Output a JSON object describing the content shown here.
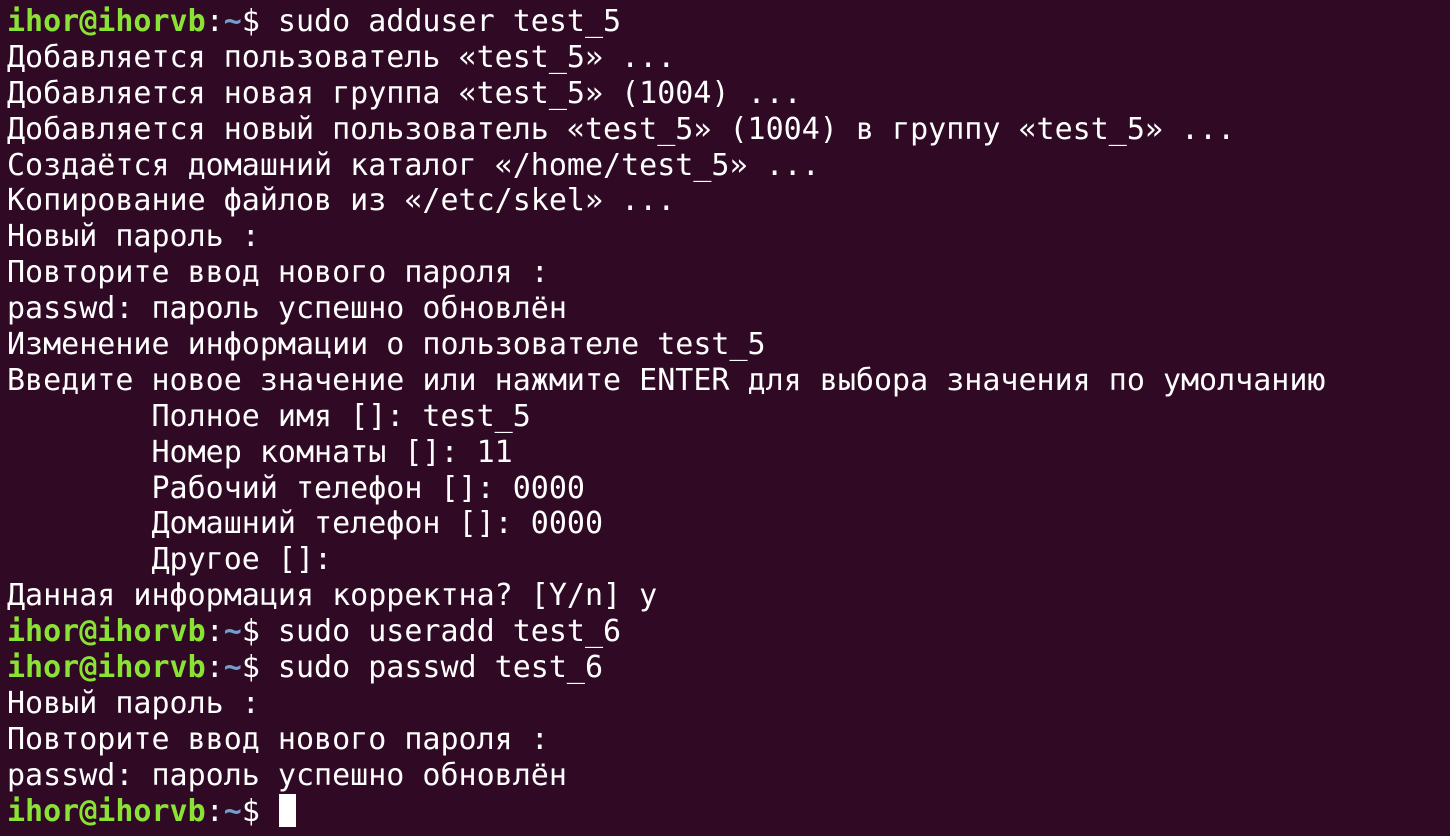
{
  "prompt": {
    "user_host": "ihor@ihorvb",
    "colon": ":",
    "path": "~",
    "dollar": "$"
  },
  "lines": [
    {
      "type": "prompt",
      "command": " sudo adduser test_5"
    },
    {
      "type": "output",
      "text": "Добавляется пользователь «test_5» ..."
    },
    {
      "type": "output",
      "text": "Добавляется новая группа «test_5» (1004) ..."
    },
    {
      "type": "output",
      "text": "Добавляется новый пользователь «test_5» (1004) в группу «test_5» ..."
    },
    {
      "type": "output",
      "text": "Создаётся домашний каталог «/home/test_5» ..."
    },
    {
      "type": "output",
      "text": "Копирование файлов из «/etc/skel» ..."
    },
    {
      "type": "output",
      "text": "Новый пароль :"
    },
    {
      "type": "output",
      "text": "Повторите ввод нового пароля :"
    },
    {
      "type": "output",
      "text": "passwd: пароль успешно обновлён"
    },
    {
      "type": "output",
      "text": "Изменение информации о пользователе test_5"
    },
    {
      "type": "output",
      "text": "Введите новое значение или нажмите ENTER для выбора значения по умолчанию"
    },
    {
      "type": "output",
      "text": "\tПолное имя []: test_5"
    },
    {
      "type": "output",
      "text": "\tНомер комнаты []: 11"
    },
    {
      "type": "output",
      "text": "\tРабочий телефон []: 0000"
    },
    {
      "type": "output",
      "text": "\tДомашний телефон []: 0000"
    },
    {
      "type": "output",
      "text": "\tДругое []:"
    },
    {
      "type": "output",
      "text": "Данная информация корректна? [Y/n] y"
    },
    {
      "type": "prompt",
      "command": " sudo useradd test_6"
    },
    {
      "type": "prompt",
      "command": " sudo passwd test_6"
    },
    {
      "type": "output",
      "text": "Новый пароль :"
    },
    {
      "type": "output",
      "text": "Повторите ввод нового пароля :"
    },
    {
      "type": "output",
      "text": "passwd: пароль успешно обновлён"
    },
    {
      "type": "prompt",
      "command": " ",
      "cursor": true
    }
  ],
  "colors": {
    "background": "#300a24",
    "text": "#ffffff",
    "user_host": "#8ae234",
    "path": "#729fcf"
  }
}
